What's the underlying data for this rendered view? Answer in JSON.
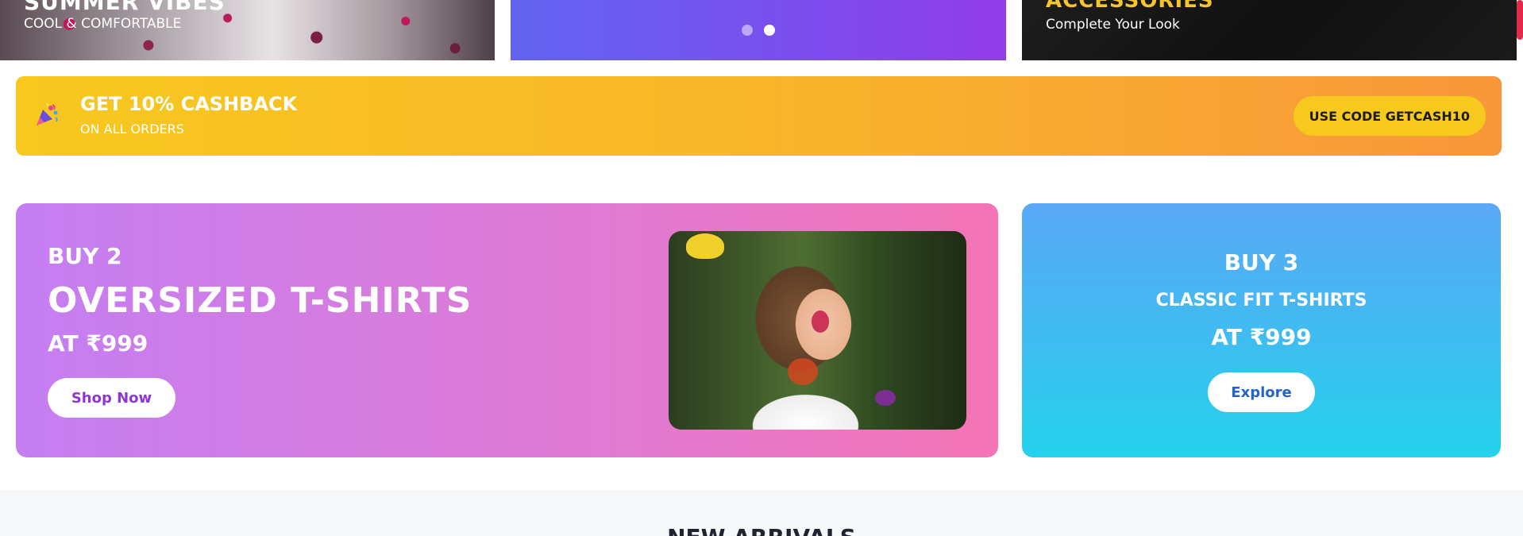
{
  "hero": {
    "left": {
      "title": "SUMMER VIBES",
      "subtitle": "COOL & COMFORTABLE"
    },
    "middle": {
      "dots": [
        {
          "active": false
        },
        {
          "active": true
        }
      ]
    },
    "right": {
      "title": "ACCESSORIES",
      "subtitle": "Complete Your Look",
      "title_color": "#f7c52a"
    }
  },
  "cashback": {
    "icon": "party-popper-icon",
    "title": "GET 10% CASHBACK",
    "subtitle": "ON ALL ORDERS",
    "code_button": "USE CODE GETCASH10",
    "gradient_start": "#f7c81e",
    "gradient_end": "#f8973a"
  },
  "promo_oversized": {
    "buy": "BUY 2",
    "title": "OVERSIZED T-SHIRTS",
    "price": "AT ₹999",
    "button": "Shop Now",
    "gradient_start": "#c47ef2",
    "gradient_end": "#f474b5"
  },
  "promo_classic": {
    "buy": "BUY 3",
    "title": "CLASSIC FIT T-SHIRTS",
    "price": "AT ₹999",
    "button": "Explore",
    "gradient_start": "#5aa8f6",
    "gradient_end": "#24d2ec"
  },
  "new_arrivals": {
    "heading": "NEW ARRIVALS"
  }
}
